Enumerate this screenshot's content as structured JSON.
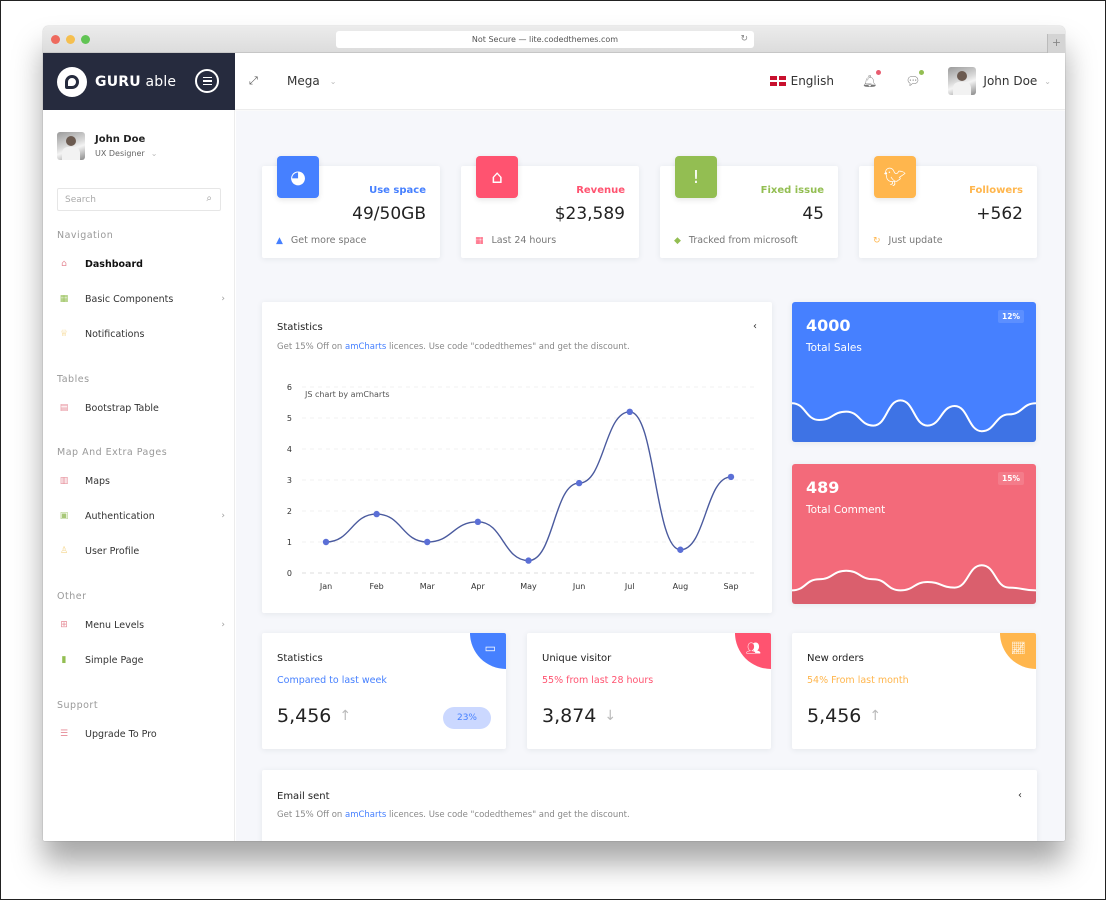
{
  "browser": {
    "address": "Not Secure — lite.codedthemes.com",
    "new_tab_label": "+"
  },
  "brand": {
    "name_bold": "GURU",
    "name_light": "able"
  },
  "topbar": {
    "mega_label": "Mega",
    "language": "English",
    "user_name": "John Doe",
    "notification_dot_color": "#e85c6f",
    "message_dot_color": "#93be52"
  },
  "sidebar": {
    "user": {
      "name": "John Doe",
      "role": "UX Designer"
    },
    "search_placeholder": "Search",
    "sections": [
      {
        "title": "Navigation",
        "items": [
          {
            "label": "Dashboard",
            "icon": "home-icon",
            "active": true,
            "has_submenu": false
          },
          {
            "label": "Basic Components",
            "icon": "grid-icon",
            "has_submenu": true
          },
          {
            "label": "Notifications",
            "icon": "crown-icon",
            "has_submenu": false
          }
        ]
      },
      {
        "title": "Tables",
        "items": [
          {
            "label": "Bootstrap Table",
            "icon": "table-icon",
            "has_submenu": false
          }
        ]
      },
      {
        "title": "Map And Extra Pages",
        "items": [
          {
            "label": "Maps",
            "icon": "map-icon",
            "has_submenu": false
          },
          {
            "label": "Authentication",
            "icon": "id-card-icon",
            "has_submenu": true
          },
          {
            "label": "User Profile",
            "icon": "user-icon",
            "has_submenu": false
          }
        ]
      },
      {
        "title": "Other",
        "items": [
          {
            "label": "Menu Levels",
            "icon": "sitemap-icon",
            "has_submenu": true
          },
          {
            "label": "Simple Page",
            "icon": "page-icon",
            "has_submenu": false
          }
        ]
      },
      {
        "title": "Support",
        "items": [
          {
            "label": "Upgrade To Pro",
            "icon": "layers-icon",
            "has_submenu": false
          }
        ]
      }
    ]
  },
  "stat_cards": [
    {
      "label": "Use space",
      "value": "49/50GB",
      "footer": "Get more space",
      "color": "#4680ff",
      "icon": "pie-chart-icon",
      "footer_icon": "warning-icon"
    },
    {
      "label": "Revenue",
      "value": "$23,589",
      "footer": "Last 24 hours",
      "color": "#ff5370",
      "icon": "home-icon",
      "footer_icon": "calendar-icon"
    },
    {
      "label": "Fixed issue",
      "value": "45",
      "footer": "Tracked from microsoft",
      "color": "#93be52",
      "icon": "alert-icon",
      "footer_icon": "tag-icon"
    },
    {
      "label": "Followers",
      "value": "+562",
      "footer": "Just update",
      "color": "#ffb64d",
      "icon": "twitter-icon",
      "footer_icon": "refresh-icon"
    }
  ],
  "statistics_card": {
    "title": "Statistics",
    "subtitle_prefix": "Get 15% Off on ",
    "subtitle_link": "amCharts",
    "subtitle_suffix": " licences. Use code \"codedthemes\" and get the discount.",
    "credit": "JS chart by amCharts"
  },
  "chart_data": {
    "type": "line",
    "title": "Statistics",
    "xlabel": "",
    "ylabel": "",
    "categories": [
      "Jan",
      "Feb",
      "Mar",
      "Apr",
      "May",
      "Jun",
      "Jul",
      "Aug",
      "Sap"
    ],
    "values": [
      1,
      1.9,
      1,
      1.65,
      0.4,
      2.9,
      5.2,
      0.75,
      3.1
    ],
    "yticks": [
      0,
      1,
      2,
      3,
      4,
      5,
      6
    ],
    "ylim": [
      0,
      6
    ],
    "grid": true,
    "smooth": true,
    "line_color": "#4a5a9e",
    "marker_color": "#5b6fd6"
  },
  "color_cards": [
    {
      "value": "4000",
      "label": "Total Sales",
      "percent": "12%",
      "color": "#4680ff",
      "wave": [
        0.55,
        0.25,
        0.4,
        0.15,
        0.6,
        0.15,
        0.5,
        0.05,
        0.35,
        0.55
      ]
    },
    {
      "value": "489",
      "label": "Total Comment",
      "percent": "15%",
      "color": "#f36a7a",
      "wave": [
        0.1,
        0.3,
        0.45,
        0.3,
        0.1,
        0.25,
        0.15,
        0.55,
        0.15,
        0.1
      ]
    }
  ],
  "small_cards": [
    {
      "title": "Statistics",
      "subtitle": "Compared to last week",
      "value": "5,456",
      "trend": "up",
      "badge": "23%",
      "color": "#4680ff",
      "icon": "monitor-icon"
    },
    {
      "title": "Unique visitor",
      "subtitle": "55% from last 28 hours",
      "value": "3,874",
      "trend": "down",
      "color": "#ff5370",
      "icon": "users-icon"
    },
    {
      "title": "New orders",
      "subtitle": "54% From last month",
      "value": "5,456",
      "trend": "up",
      "color": "#ffb64d",
      "icon": "line-chart-icon"
    }
  ],
  "email_card": {
    "title": "Email sent",
    "subtitle_prefix": "Get 15% Off on ",
    "subtitle_link": "amCharts",
    "subtitle_suffix": " licences. Use code \"codedthemes\" and get the discount."
  },
  "icons": {
    "collapse": "‹",
    "chevron_down": "⌄",
    "chevron_right": "›",
    "arrow_up": "↑",
    "arrow_down": "↓"
  }
}
